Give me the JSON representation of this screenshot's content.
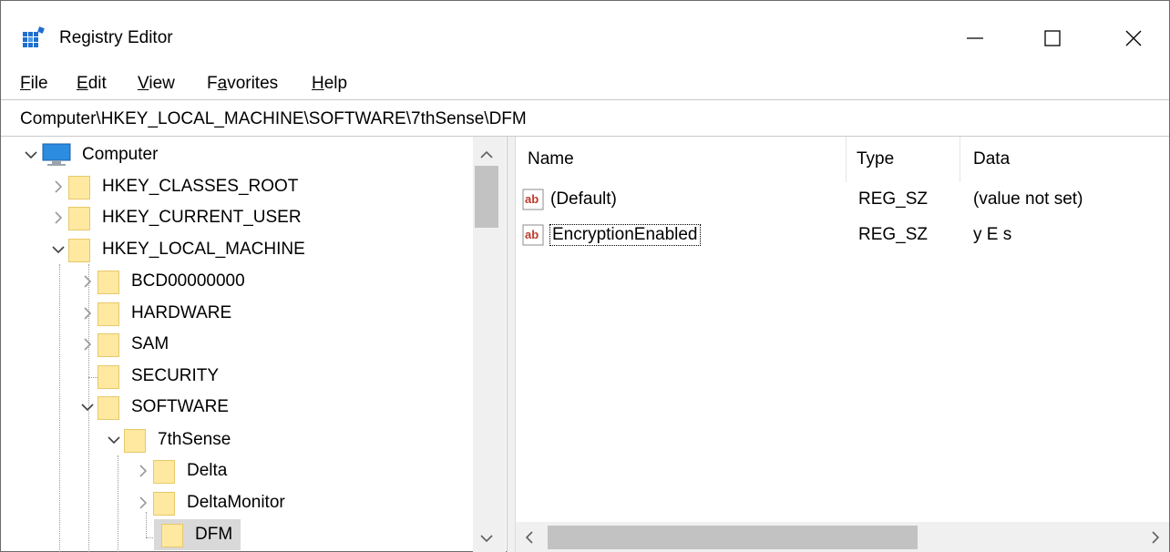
{
  "window": {
    "title": "Registry Editor",
    "icon": "registry-editor-icon"
  },
  "menu": {
    "file": "File",
    "edit": "Edit",
    "view": "View",
    "favorites": "Favorites",
    "help": "Help"
  },
  "address": {
    "path": "Computer\\HKEY_LOCAL_MACHINE\\SOFTWARE\\7thSense\\DFM"
  },
  "tree": {
    "computer": "Computer",
    "hkcr": "HKEY_CLASSES_ROOT",
    "hkcu": "HKEY_CURRENT_USER",
    "hklm": "HKEY_LOCAL_MACHINE",
    "bcd": "BCD00000000",
    "hardware": "HARDWARE",
    "sam": "SAM",
    "security": "SECURITY",
    "software": "SOFTWARE",
    "seventhsense": "7thSense",
    "delta": "Delta",
    "deltamonitor": "DeltaMonitor",
    "dfm": "DFM"
  },
  "list": {
    "headers": {
      "name": "Name",
      "type": "Type",
      "data": "Data"
    },
    "rows": [
      {
        "name": "(Default)",
        "type": "REG_SZ",
        "data": "(value not set)"
      },
      {
        "name": "EncryptionEnabled",
        "type": "REG_SZ",
        "data": "y E s"
      }
    ]
  },
  "colors": {
    "folder_fill": "#ffe9a1",
    "selection": "#d9d9d9",
    "scrollbar": "#c2c2c2",
    "icon_red": "#c0392b",
    "icon_blue": "#1f6fd1"
  }
}
